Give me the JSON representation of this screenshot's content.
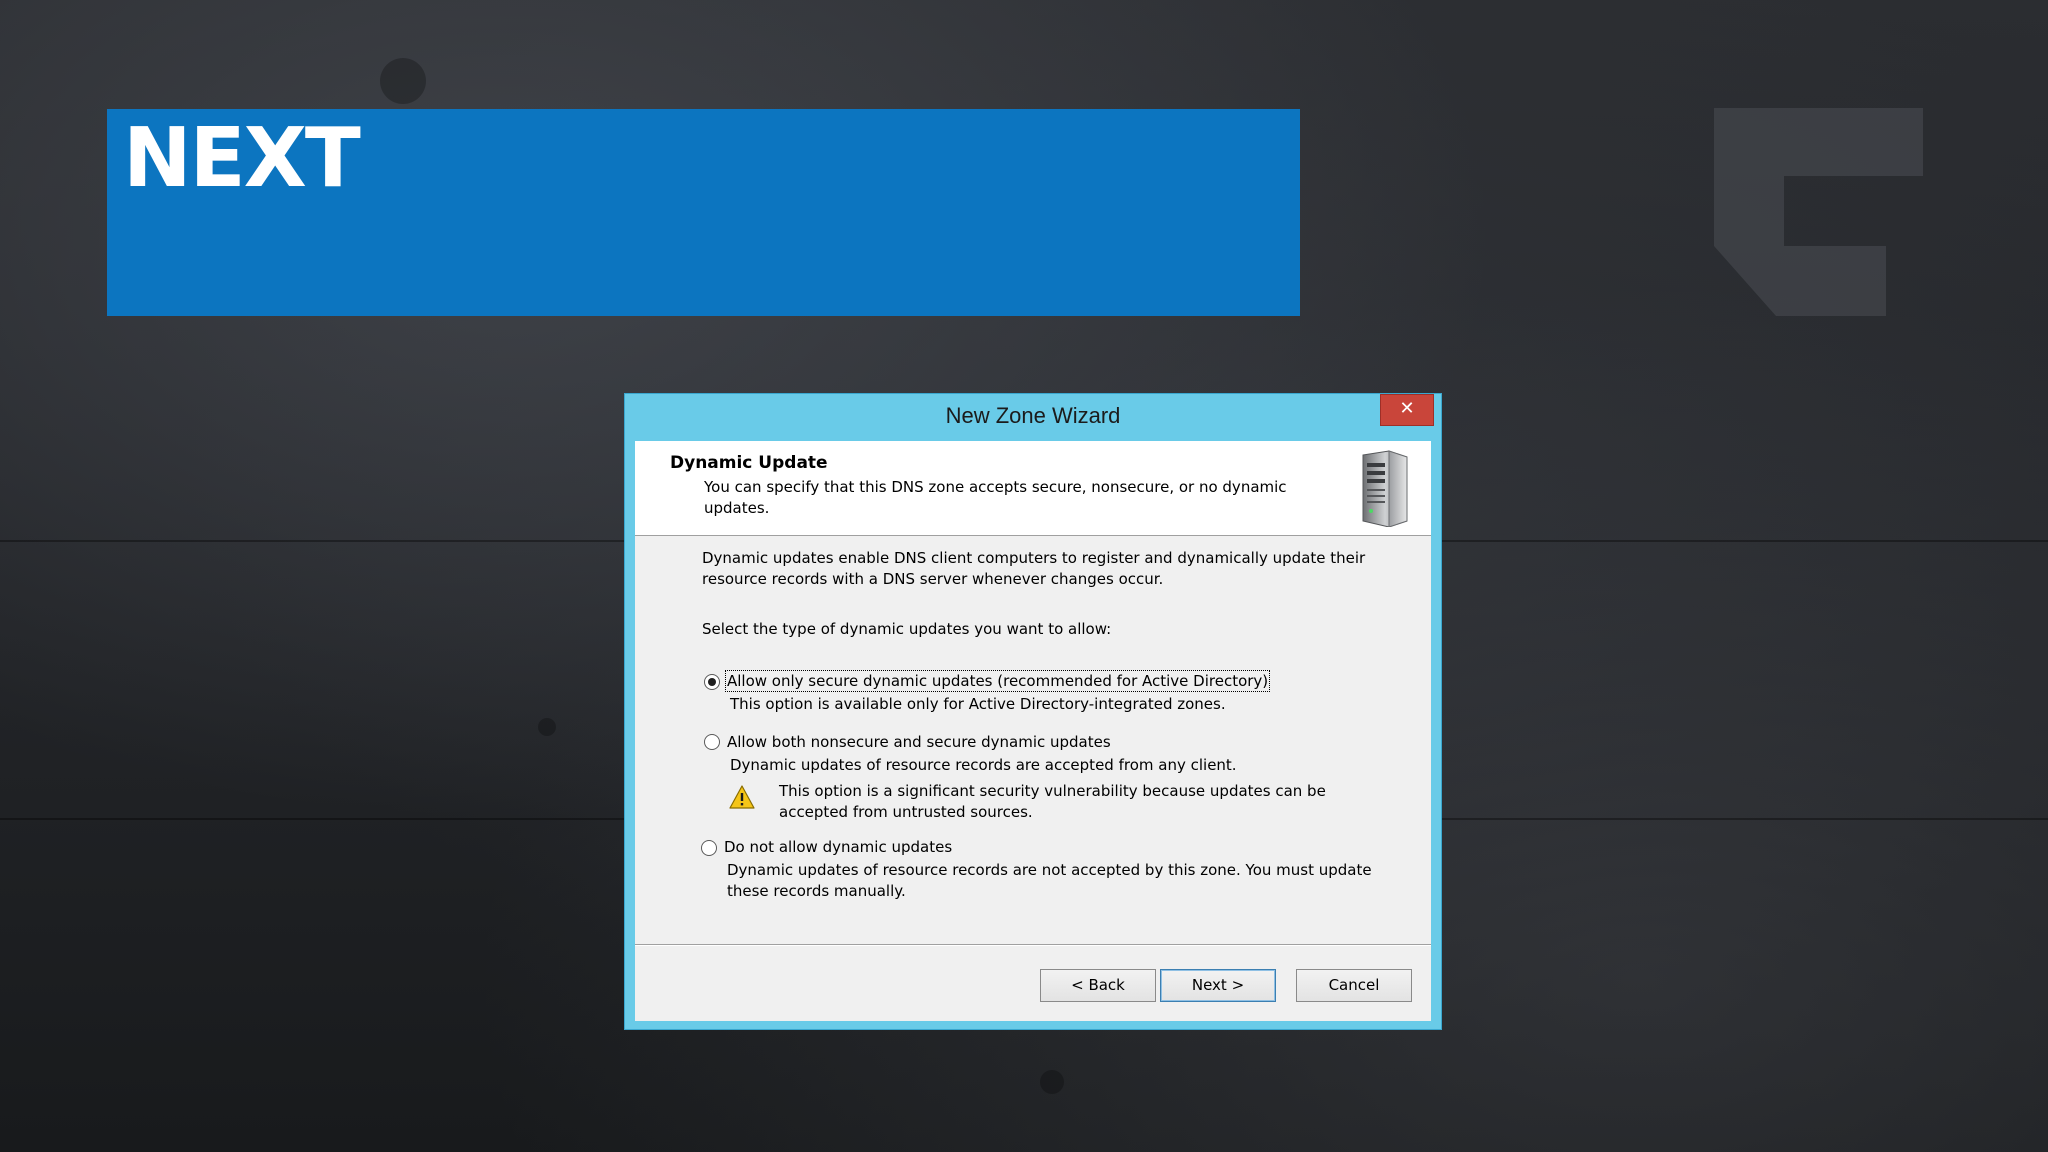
{
  "slide": {
    "title": "NEXT",
    "banner_color": "#0c75c0"
  },
  "window": {
    "title": "New Zone Wizard",
    "close_symbol": "✕",
    "accent": "#69cbe8",
    "header": {
      "title": "Dynamic Update",
      "description": "You can specify that this DNS zone accepts secure, nonsecure, or no dynamic updates.",
      "icon": "server-icon"
    },
    "intro": "Dynamic updates enable DNS client computers to register and dynamically update their resource records with a DNS server whenever changes occur.",
    "prompt": "Select the type of dynamic updates you want to allow:",
    "options": [
      {
        "label": "Allow only secure dynamic updates (recommended for Active Directory)",
        "description": "This option is available only for Active Directory-integrated zones.",
        "selected": true
      },
      {
        "label": "Allow both nonsecure and secure dynamic updates",
        "description": "Dynamic updates of resource records are accepted from any client.",
        "warning": "This option is a significant security vulnerability because updates can be accepted from untrusted sources.",
        "selected": false
      },
      {
        "label": "Do not allow dynamic updates",
        "description": "Dynamic updates of resource records are not accepted by this zone. You must update these records manually.",
        "selected": false
      }
    ],
    "buttons": {
      "back": "< Back",
      "next": "Next >",
      "cancel": "Cancel"
    }
  }
}
